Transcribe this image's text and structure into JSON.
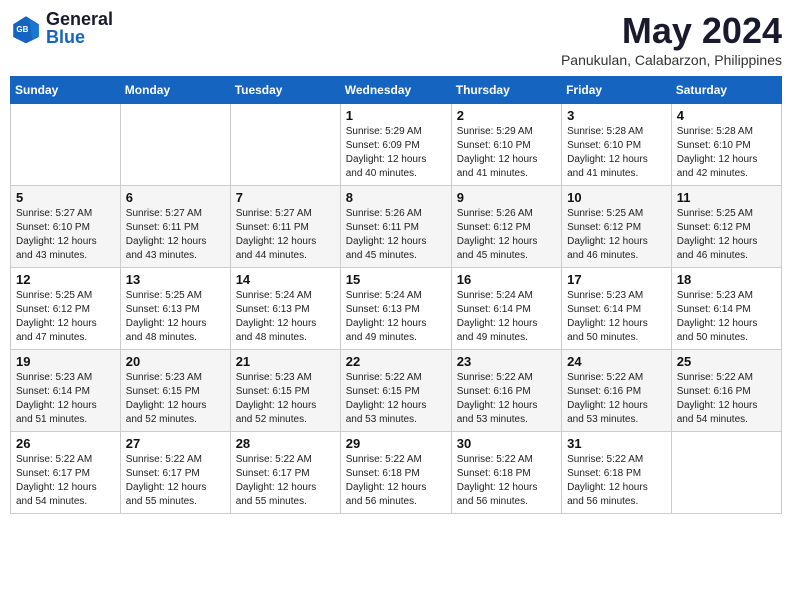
{
  "logo": {
    "line1": "General",
    "line2": "Blue"
  },
  "title": "May 2024",
  "subtitle": "Panukulan, Calabarzon, Philippines",
  "days_of_week": [
    "Sunday",
    "Monday",
    "Tuesday",
    "Wednesday",
    "Thursday",
    "Friday",
    "Saturday"
  ],
  "weeks": [
    [
      {
        "day": "",
        "info": ""
      },
      {
        "day": "",
        "info": ""
      },
      {
        "day": "",
        "info": ""
      },
      {
        "day": "1",
        "info": "Sunrise: 5:29 AM\nSunset: 6:09 PM\nDaylight: 12 hours\nand 40 minutes."
      },
      {
        "day": "2",
        "info": "Sunrise: 5:29 AM\nSunset: 6:10 PM\nDaylight: 12 hours\nand 41 minutes."
      },
      {
        "day": "3",
        "info": "Sunrise: 5:28 AM\nSunset: 6:10 PM\nDaylight: 12 hours\nand 41 minutes."
      },
      {
        "day": "4",
        "info": "Sunrise: 5:28 AM\nSunset: 6:10 PM\nDaylight: 12 hours\nand 42 minutes."
      }
    ],
    [
      {
        "day": "5",
        "info": "Sunrise: 5:27 AM\nSunset: 6:10 PM\nDaylight: 12 hours\nand 43 minutes."
      },
      {
        "day": "6",
        "info": "Sunrise: 5:27 AM\nSunset: 6:11 PM\nDaylight: 12 hours\nand 43 minutes."
      },
      {
        "day": "7",
        "info": "Sunrise: 5:27 AM\nSunset: 6:11 PM\nDaylight: 12 hours\nand 44 minutes."
      },
      {
        "day": "8",
        "info": "Sunrise: 5:26 AM\nSunset: 6:11 PM\nDaylight: 12 hours\nand 45 minutes."
      },
      {
        "day": "9",
        "info": "Sunrise: 5:26 AM\nSunset: 6:12 PM\nDaylight: 12 hours\nand 45 minutes."
      },
      {
        "day": "10",
        "info": "Sunrise: 5:25 AM\nSunset: 6:12 PM\nDaylight: 12 hours\nand 46 minutes."
      },
      {
        "day": "11",
        "info": "Sunrise: 5:25 AM\nSunset: 6:12 PM\nDaylight: 12 hours\nand 46 minutes."
      }
    ],
    [
      {
        "day": "12",
        "info": "Sunrise: 5:25 AM\nSunset: 6:12 PM\nDaylight: 12 hours\nand 47 minutes."
      },
      {
        "day": "13",
        "info": "Sunrise: 5:25 AM\nSunset: 6:13 PM\nDaylight: 12 hours\nand 48 minutes."
      },
      {
        "day": "14",
        "info": "Sunrise: 5:24 AM\nSunset: 6:13 PM\nDaylight: 12 hours\nand 48 minutes."
      },
      {
        "day": "15",
        "info": "Sunrise: 5:24 AM\nSunset: 6:13 PM\nDaylight: 12 hours\nand 49 minutes."
      },
      {
        "day": "16",
        "info": "Sunrise: 5:24 AM\nSunset: 6:14 PM\nDaylight: 12 hours\nand 49 minutes."
      },
      {
        "day": "17",
        "info": "Sunrise: 5:23 AM\nSunset: 6:14 PM\nDaylight: 12 hours\nand 50 minutes."
      },
      {
        "day": "18",
        "info": "Sunrise: 5:23 AM\nSunset: 6:14 PM\nDaylight: 12 hours\nand 50 minutes."
      }
    ],
    [
      {
        "day": "19",
        "info": "Sunrise: 5:23 AM\nSunset: 6:14 PM\nDaylight: 12 hours\nand 51 minutes."
      },
      {
        "day": "20",
        "info": "Sunrise: 5:23 AM\nSunset: 6:15 PM\nDaylight: 12 hours\nand 52 minutes."
      },
      {
        "day": "21",
        "info": "Sunrise: 5:23 AM\nSunset: 6:15 PM\nDaylight: 12 hours\nand 52 minutes."
      },
      {
        "day": "22",
        "info": "Sunrise: 5:22 AM\nSunset: 6:15 PM\nDaylight: 12 hours\nand 53 minutes."
      },
      {
        "day": "23",
        "info": "Sunrise: 5:22 AM\nSunset: 6:16 PM\nDaylight: 12 hours\nand 53 minutes."
      },
      {
        "day": "24",
        "info": "Sunrise: 5:22 AM\nSunset: 6:16 PM\nDaylight: 12 hours\nand 53 minutes."
      },
      {
        "day": "25",
        "info": "Sunrise: 5:22 AM\nSunset: 6:16 PM\nDaylight: 12 hours\nand 54 minutes."
      }
    ],
    [
      {
        "day": "26",
        "info": "Sunrise: 5:22 AM\nSunset: 6:17 PM\nDaylight: 12 hours\nand 54 minutes."
      },
      {
        "day": "27",
        "info": "Sunrise: 5:22 AM\nSunset: 6:17 PM\nDaylight: 12 hours\nand 55 minutes."
      },
      {
        "day": "28",
        "info": "Sunrise: 5:22 AM\nSunset: 6:17 PM\nDaylight: 12 hours\nand 55 minutes."
      },
      {
        "day": "29",
        "info": "Sunrise: 5:22 AM\nSunset: 6:18 PM\nDaylight: 12 hours\nand 56 minutes."
      },
      {
        "day": "30",
        "info": "Sunrise: 5:22 AM\nSunset: 6:18 PM\nDaylight: 12 hours\nand 56 minutes."
      },
      {
        "day": "31",
        "info": "Sunrise: 5:22 AM\nSunset: 6:18 PM\nDaylight: 12 hours\nand 56 minutes."
      },
      {
        "day": "",
        "info": ""
      }
    ]
  ]
}
